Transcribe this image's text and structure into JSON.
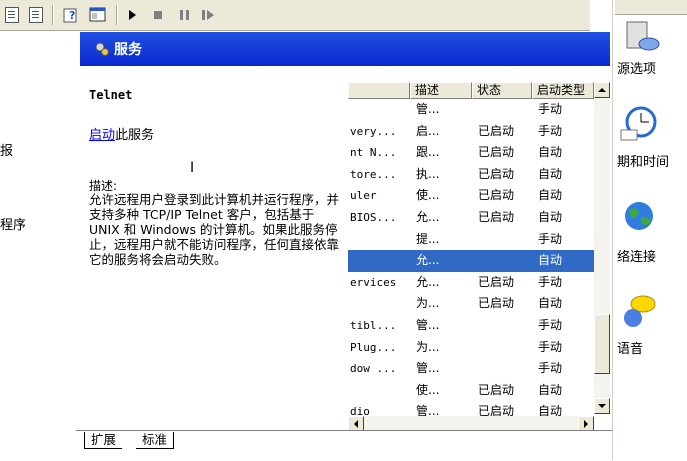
{
  "toolbar": {
    "buttons": [
      "refresh",
      "export-list",
      "help",
      "properties",
      "start",
      "stop",
      "pause",
      "restart"
    ]
  },
  "left_strip": {
    "items": [
      "报",
      "程序"
    ]
  },
  "services": {
    "header_title": "服务",
    "selected_name": "Telnet",
    "start_link": "启动",
    "start_suffix": "此服务",
    "desc_label": "描述:",
    "desc_text": "允许远程用户登录到此计算机并运行程序，并支持多种 TCP/IP Telnet 客户，包括基于 UNIX 和 Windows 的计算机。如果此服务停止，远程用户就不能访问程序，任何直接依靠它的服务将会启动失败。"
  },
  "list": {
    "columns": [
      "",
      "描述",
      "状态",
      "启动类型"
    ],
    "rows": [
      {
        "name": "",
        "desc": "管...",
        "status": "",
        "startup": "手动"
      },
      {
        "name": "very...",
        "desc": "启...",
        "status": "已启动",
        "startup": "手动"
      },
      {
        "name": "nt N...",
        "desc": "跟...",
        "status": "已启动",
        "startup": "自动"
      },
      {
        "name": "tore...",
        "desc": "执...",
        "status": "已启动",
        "startup": "自动"
      },
      {
        "name": "uler",
        "desc": "使...",
        "status": "已启动",
        "startup": "自动"
      },
      {
        "name": "BIOS...",
        "desc": "允...",
        "status": "已启动",
        "startup": "自动"
      },
      {
        "name": "",
        "desc": "提...",
        "status": "",
        "startup": "手动"
      },
      {
        "name": "",
        "desc": "允...",
        "status": "",
        "startup": "自动"
      },
      {
        "name": "ervices",
        "desc": "允...",
        "status": "已启动",
        "startup": "手动"
      },
      {
        "name": "",
        "desc": "为...",
        "status": "已启动",
        "startup": "自动"
      },
      {
        "name": "tibl...",
        "desc": "管...",
        "status": "",
        "startup": "手动"
      },
      {
        "name": "Plug...",
        "desc": "为...",
        "status": "",
        "startup": "手动"
      },
      {
        "name": "dow ...",
        "desc": "管...",
        "status": "",
        "startup": "手动"
      },
      {
        "name": "",
        "desc": "使...",
        "status": "已启动",
        "startup": "自动"
      },
      {
        "name": "dio",
        "desc": "管...",
        "status": "已启动",
        "startup": "自动"
      }
    ],
    "selected_index": 7
  },
  "tabs": [
    "扩展",
    "标准"
  ],
  "control_panel": {
    "items": [
      "源选项",
      "期和时间",
      "络连接",
      "语音"
    ]
  }
}
